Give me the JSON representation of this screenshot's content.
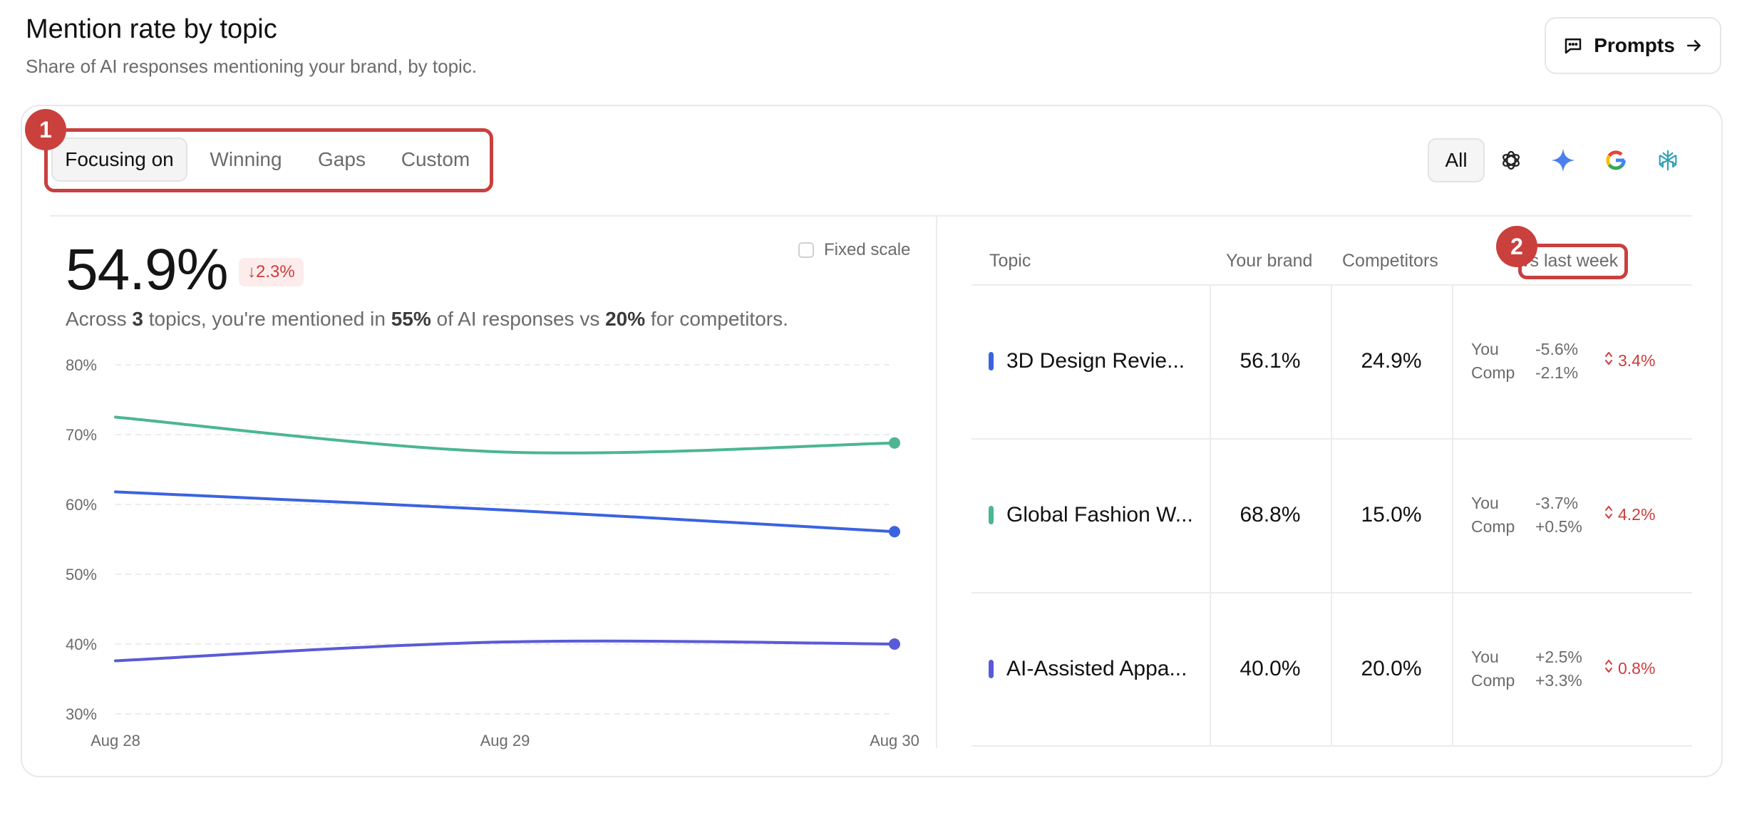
{
  "header": {
    "title": "Mention rate by topic",
    "subtitle": "Share of AI responses mentioning your brand, by topic.",
    "prompts_button": "Prompts"
  },
  "annotations": {
    "badge1": "1",
    "badge2": "2"
  },
  "tabs": [
    {
      "label": "Focusing on",
      "active": true
    },
    {
      "label": "Winning",
      "active": false
    },
    {
      "label": "Gaps",
      "active": false
    },
    {
      "label": "Custom",
      "active": false
    }
  ],
  "models": {
    "all_label": "All",
    "icons": [
      "chatgpt-icon",
      "gemini-icon",
      "google-icon",
      "perplexity-icon"
    ]
  },
  "summary": {
    "big_value": "54.9%",
    "delta": "↓2.3%",
    "fixed_scale_label": "Fixed scale",
    "text_prefix": "Across ",
    "topics_count": "3",
    "text_mid1": " topics, you're mentioned in ",
    "brand_pct": "55%",
    "text_mid2": " of AI responses vs ",
    "competitor_pct": "20%",
    "text_suffix": " for competitors."
  },
  "chart_data": {
    "type": "line",
    "x": [
      "Aug 28",
      "Aug 29",
      "Aug 30"
    ],
    "ylim": [
      30,
      80
    ],
    "yticks": [
      "80%",
      "70%",
      "60%",
      "50%",
      "40%",
      "30%"
    ],
    "grid": true,
    "series": [
      {
        "color": "#4bb594",
        "values": [
          72.5,
          67.5,
          68.8
        ]
      },
      {
        "color": "#3b63e0",
        "values": [
          61.8,
          59.2,
          56.1
        ]
      },
      {
        "color": "#5a5ad8",
        "values": [
          37.6,
          40.3,
          40.0
        ]
      }
    ]
  },
  "table": {
    "headers": {
      "topic": "Topic",
      "your_brand": "Your brand",
      "competitors": "Competitors",
      "vs": "vs last week"
    },
    "you_label": "You",
    "comp_label": "Comp",
    "rows": [
      {
        "topic": "3D Design Revie...",
        "color": "#3b63e0",
        "your_brand": "56.1%",
        "competitors": "24.9%",
        "you_change": "-5.6%",
        "comp_change": "-2.1%",
        "gap_change": "3.4%"
      },
      {
        "topic": "Global Fashion W...",
        "color": "#4bb594",
        "your_brand": "68.8%",
        "competitors": "15.0%",
        "you_change": "-3.7%",
        "comp_change": "+0.5%",
        "gap_change": "4.2%"
      },
      {
        "topic": "AI-Assisted Appa...",
        "color": "#5a5ad8",
        "your_brand": "40.0%",
        "competitors": "20.0%",
        "you_change": "+2.5%",
        "comp_change": "+3.3%",
        "gap_change": "0.8%"
      }
    ]
  }
}
